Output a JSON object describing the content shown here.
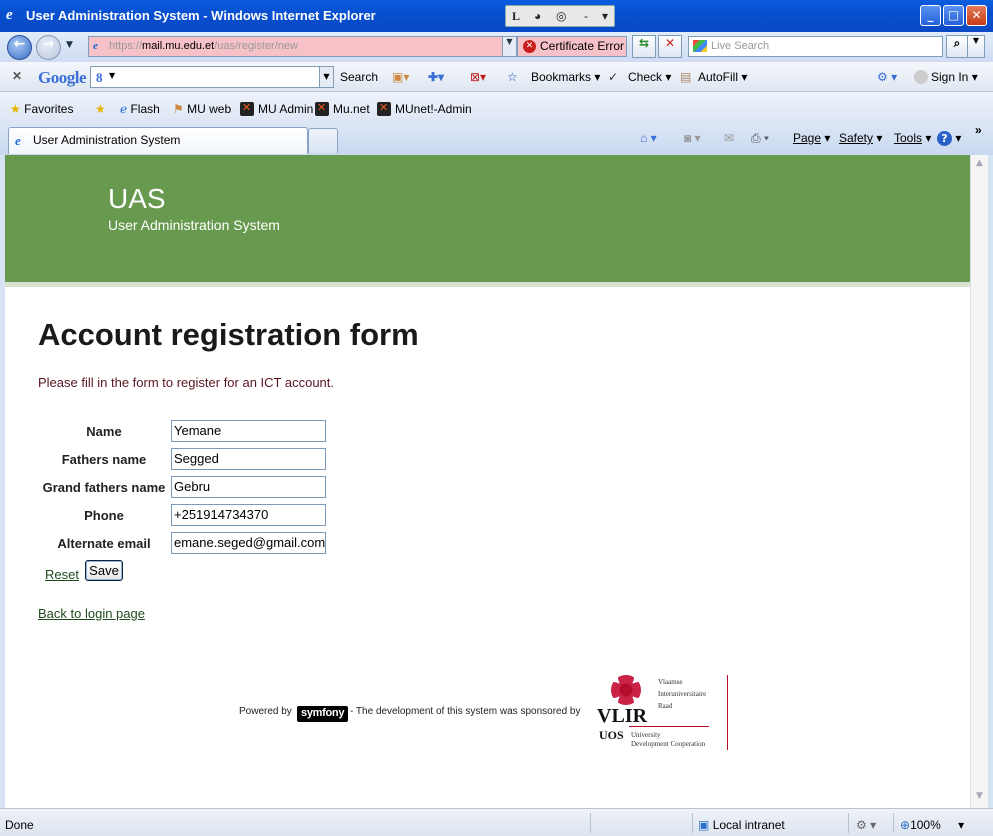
{
  "window": {
    "title": "User Administration System - Windows Internet Explorer",
    "controls": [
      "_",
      "□",
      "✕"
    ],
    "ie_letter": "e",
    "lbox": [
      "L",
      "◕",
      "◎",
      "-",
      "▾"
    ]
  },
  "address": {
    "url_prefix": "https://",
    "url_host": "mail.mu.edu.et",
    "url_path": "/uas/register/new",
    "cert_error": "Certificate Error",
    "search_placeholder": "Live Search"
  },
  "google_bar": {
    "logo": "Google",
    "search_label": "Search",
    "bookmarks": "Bookmarks",
    "check": "Check",
    "autofill": "AutoFill",
    "sign_in": "Sign In",
    "g_value": "8"
  },
  "favorites": {
    "label": "Favorites",
    "items": [
      "Flash",
      "MU web",
      "MU Admin",
      "Mu.net",
      "MUnet!-Admin"
    ]
  },
  "tab": {
    "title": "User Administration System"
  },
  "command_bar": {
    "page": "Page",
    "safety": "Safety",
    "tools": "Tools"
  },
  "header": {
    "title": "UAS",
    "subtitle": "User Administration System"
  },
  "form": {
    "title": "Account registration form",
    "intro": "Please fill in the form to register for an ICT account.",
    "fields": [
      {
        "label": "Name",
        "value": "Yemane"
      },
      {
        "label": "Fathers name",
        "value": "Segged"
      },
      {
        "label": "Grand fathers name",
        "value": "Gebru"
      },
      {
        "label": "Phone",
        "value": "+251914734370"
      },
      {
        "label": "Alternate email",
        "value": "emane.seged@gmail.com"
      }
    ],
    "reset": "Reset",
    "save": "Save",
    "back": "Back to login page"
  },
  "footer": {
    "powered_by": "Powered by",
    "symfony": "symfony",
    "sponsored": "-  The development of this system was sponsored by",
    "vlir": "VLIR",
    "uos": "UOS",
    "vlir_lines": [
      "Vlaamse",
      "Interuniversitaire",
      "Raad"
    ],
    "uos_lines": [
      "University",
      "Development Cooperation"
    ]
  },
  "status": {
    "left": "Done",
    "zone": "Local intranet",
    "zoom": "100%"
  },
  "colors": {
    "header_green": "#679a4e",
    "link_green": "#1f4b1f",
    "cert_pink": "#f6c1c7"
  }
}
